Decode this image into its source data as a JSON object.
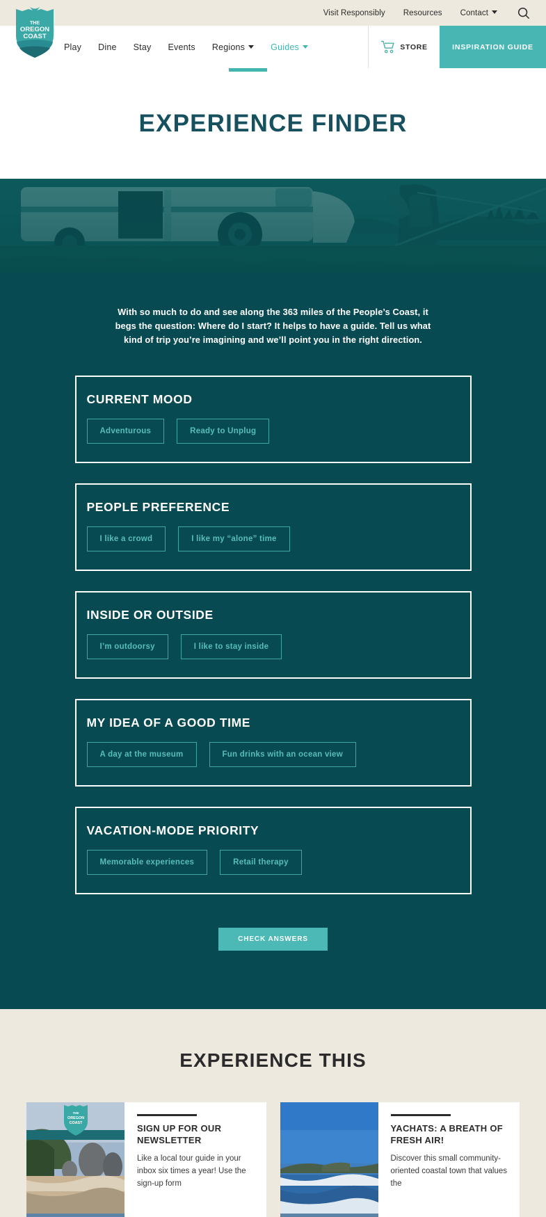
{
  "brand": {
    "logo_alt": "The Oregon Coast",
    "logo_line1": "THE",
    "logo_line2": "OREGON",
    "logo_line3": "COAST",
    "accent_teal": "#48b6b3",
    "deep_teal": "#084a52",
    "title_teal": "#17505e",
    "cream": "#ede9df"
  },
  "utility_nav": {
    "items": [
      {
        "label": "Visit Responsibly",
        "has_caret": false
      },
      {
        "label": "Resources",
        "has_caret": false
      },
      {
        "label": "Contact",
        "has_caret": true
      }
    ],
    "search_icon": "search-icon"
  },
  "main_nav": {
    "items": [
      {
        "label": "Play",
        "has_caret": false,
        "active": false
      },
      {
        "label": "Dine",
        "has_caret": false,
        "active": false
      },
      {
        "label": "Stay",
        "has_caret": false,
        "active": false
      },
      {
        "label": "Events",
        "has_caret": false,
        "active": false
      },
      {
        "label": "Regions",
        "has_caret": true,
        "active": false
      },
      {
        "label": "Guides",
        "has_caret": true,
        "active": true
      }
    ],
    "store_label": "STORE",
    "store_icon": "shopping-cart-icon",
    "inspiration_label": "INSPIRATION GUIDE"
  },
  "page": {
    "title": "EXPERIENCE FINDER",
    "hero_alt": "Person fishing beside a camper van on the Oregon Coast",
    "intro": "With so much to do and see along the 363 miles of the People’s Coast, it begs the question: Where do I start? It helps to have a guide. Tell us what kind of trip you’re imagining and we’ll point you in the right direction."
  },
  "quiz": {
    "cards": [
      {
        "label": "CURRENT MOOD",
        "options": [
          "Adventurous",
          "Ready to Unplug"
        ]
      },
      {
        "label": "PEOPLE PREFERENCE",
        "options": [
          "I like a crowd",
          "I like my “alone” time"
        ]
      },
      {
        "label": "INSIDE OR OUTSIDE",
        "options": [
          "I’m outdoorsy",
          "I like to stay inside"
        ]
      },
      {
        "label": "MY IDEA OF A GOOD TIME",
        "options": [
          "A day at the museum",
          "Fun drinks with an ocean view"
        ]
      },
      {
        "label": "VACATION-MODE PRIORITY",
        "options": [
          "Memorable experiences",
          "Retail therapy"
        ]
      }
    ],
    "submit_label": "CHECK ANSWERS"
  },
  "experience_this": {
    "heading": "EXPERIENCE THIS",
    "cards": [
      {
        "title": "SIGN UP FOR OUR NEWSLETTER",
        "text": "Like a local tour guide in your inbox six times a year!  Use the sign-up form",
        "image_alt": "Rocky coastline with sea stacks at sunset",
        "has_shield_badge": true
      },
      {
        "title": "YACHATS: A BREATH OF FRESH AIR!",
        "text": "Discover this small community-oriented coastal town that values the",
        "image_alt": "Yachats coastline with blue sky and ocean",
        "has_shield_badge": false
      }
    ]
  }
}
